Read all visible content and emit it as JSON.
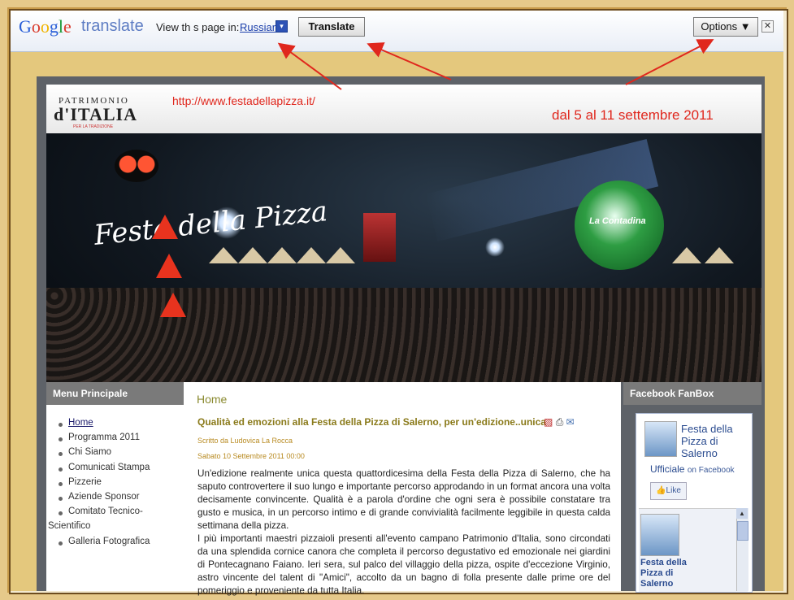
{
  "google_translate": {
    "logo_letters": [
      "G",
      "o",
      "o",
      "g",
      "l",
      "e"
    ],
    "product": "translate",
    "view_label": "View th s page in:",
    "language": "Russian",
    "dropdown_glyph": "▾",
    "translate_button": "Translate",
    "options_button": "Options ▼",
    "close_glyph": "✕"
  },
  "site": {
    "logo_line1": "PATRIMONIO",
    "logo_line2": "d'ITALIA",
    "logo_line3": "PER LA TRADIZIONE",
    "url": "http://www.festadellapizza.it/",
    "dates": "dal 5 al 11 settembre 2011"
  },
  "banner": {
    "logo_text": "Festa della Pizza",
    "balloon_text": "La Contadina"
  },
  "menu": {
    "heading": "Menu Principale",
    "items": [
      "Home",
      "Programma 2011",
      "Chi Siamo",
      "Comunicati Stampa",
      "Pizzerie",
      "Aziende Sponsor",
      "Comitato Tecnico-",
      "Scientifico",
      "Galleria Fotografica"
    ]
  },
  "article": {
    "breadcrumb": "Home",
    "title": "Qualità ed emozioni alla Festa della Pizza di Salerno, per un'edizione..unica",
    "icons": "pdf-icon print-icon email-icon",
    "author": "Scritto da Ludovica La Rocca",
    "date": "Sabato 10 Settembre 2011 00:00",
    "body_p1": "Un'edizione realmente unica questa quattordicesima della Festa della Pizza di Salerno, che ha saputo controvertere il suo lungo e importante percorso approdando in un format ancora una volta decisamente convincente. Qualità è a parola d'ordine che ogni sera è possibile constatare tra gusto e musica, in un percorso intimo e di grande convivialità facilmente leggibile in questa calda settimana della pizza.",
    "body_p2": "I più importanti maestri pizzaioli presenti all'evento campano Patrimonio d'Italia, sono circondati da una splendida cornice canora che completa il percorso degustativo ed emozionale nei giardini di Pontecagnano Faiano. Ieri sera, sul palco del villaggio della pizza, ospite d'eccezione Virginio, astro vincente del talent di \"Amici\", accolto da un bagno di folla presente dalle prime ore del pomeriggio e proveniente da tutta Italia."
  },
  "facebook": {
    "heading": "Facebook FanBox",
    "page_name": "Festa della Pizza di Salerno",
    "page_name_last": "Ufficiale",
    "on_facebook": "on Facebook",
    "like": "Like",
    "like_icon": "thumbs-up-icon",
    "post_title": "Festa della Pizza di Salerno"
  },
  "colors": {
    "arrow": "#e0271d",
    "frame": "#e6c98a",
    "link": "#1a3eaa"
  }
}
